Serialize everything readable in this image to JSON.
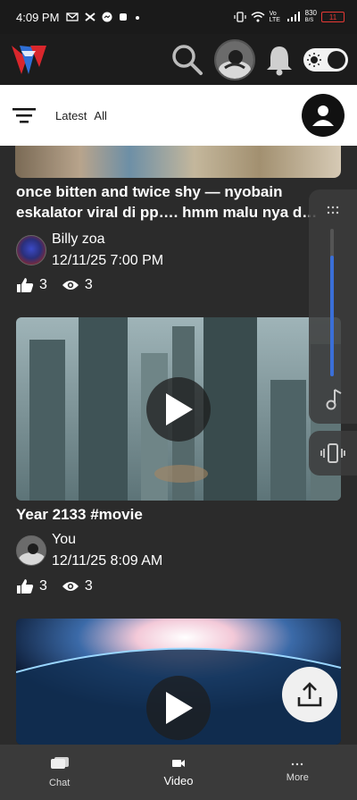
{
  "status": {
    "time": "4:09 PM",
    "network_speed_top": "830",
    "network_speed_unit": "B/S",
    "battery": "11",
    "volte_label": "Vo LTE"
  },
  "header": {
    "icons": [
      "app-logo",
      "search-icon",
      "avatar",
      "bell-icon",
      "theme-toggle"
    ]
  },
  "filter_bar": {
    "latest_label": "Latest",
    "all_label": "All"
  },
  "posts": [
    {
      "title": "once bitten and twice shy — nyobain eskalator viral di pp…. hmm malu nya d…",
      "author": "Billy zoa",
      "date": "12/11/25 7:00 PM",
      "likes": "3",
      "views": "3"
    },
    {
      "title": "Year 2133 #movie",
      "author": "You",
      "date": "12/11/25 8:09 AM",
      "likes": "3",
      "views": "3"
    }
  ],
  "side_panel": {
    "volume_level": 0.82
  },
  "bottom_nav": {
    "chat_label": "Chat",
    "video_label": "Video",
    "more_label": "More"
  },
  "colors": {
    "accent": "#3a6fd8",
    "battery_low": "#e53935",
    "logo_red": "#d9262c",
    "logo_blue": "#2f6fd6"
  }
}
